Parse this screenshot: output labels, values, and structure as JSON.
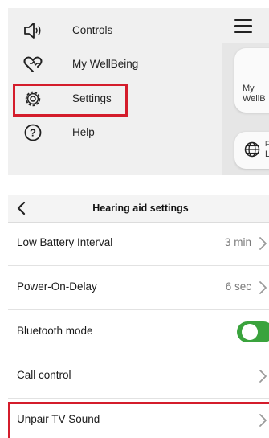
{
  "menu": {
    "items": [
      {
        "label": "Controls",
        "icon": "speaker-icon"
      },
      {
        "label": "My WellBeing",
        "icon": "heart-icon"
      },
      {
        "label": "Settings",
        "icon": "gear-icon"
      },
      {
        "label": "Help",
        "icon": "help-circle-icon"
      }
    ],
    "highlight_color": "#d41c2b"
  },
  "background_screen": {
    "card_wellbeing_label": "My\nWellB",
    "card_globe_fragment_top": "F",
    "card_globe_fragment_bottom": "L"
  },
  "settings": {
    "title": "Hearing aid settings",
    "back_icon": "chevron-left-icon",
    "rows": [
      {
        "label": "Low Battery Interval",
        "value": "3 min",
        "control": "chevron"
      },
      {
        "label": "Power-On-Delay",
        "value": "6 sec",
        "control": "chevron"
      },
      {
        "label": "Bluetooth mode",
        "value": "",
        "control": "toggle",
        "toggle_on": true
      },
      {
        "label": "Call control",
        "value": "",
        "control": "chevron"
      },
      {
        "label": "Unpair TV Sound",
        "value": "",
        "control": "chevron"
      }
    ],
    "toggle_color": "#3aa33d",
    "highlight_color": "#d41c2b"
  }
}
